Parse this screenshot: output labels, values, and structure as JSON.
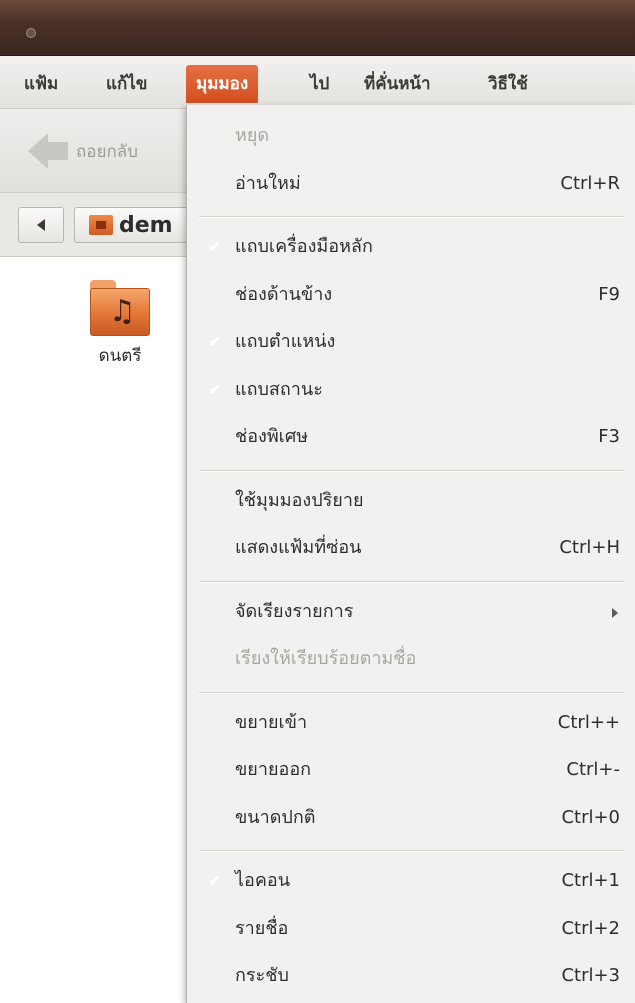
{
  "menubar": {
    "items": [
      {
        "label": "แฟ้ม",
        "active": false
      },
      {
        "label": "แก้ไข",
        "active": false
      },
      {
        "label": "มุมมอง",
        "active": true
      },
      {
        "label": "ไป",
        "active": false
      },
      {
        "label": "ที่คั่นหน้า",
        "active": false
      },
      {
        "label": "วิธีใช้",
        "active": false
      }
    ]
  },
  "toolbar": {
    "back_label": "ถอยกลับ"
  },
  "location": {
    "crumb": "dem"
  },
  "files": [
    {
      "label": "ดนตรี",
      "icon": "music-folder-icon"
    }
  ],
  "view_menu": {
    "items": [
      {
        "type": "item",
        "label": "หยุด",
        "shortcut": "",
        "disabled": true,
        "checked": false,
        "submenu": false
      },
      {
        "type": "item",
        "label": "อ่านใหม่",
        "shortcut": "Ctrl+R",
        "disabled": false,
        "checked": false,
        "submenu": false
      },
      {
        "type": "separator"
      },
      {
        "type": "item",
        "label": "แถบเครื่องมือหลัก",
        "shortcut": "",
        "disabled": false,
        "checked": true,
        "submenu": false
      },
      {
        "type": "item",
        "label": "ช่องด้านข้าง",
        "shortcut": "F9",
        "disabled": false,
        "checked": false,
        "submenu": false
      },
      {
        "type": "item",
        "label": "แถบตำแหน่ง",
        "shortcut": "",
        "disabled": false,
        "checked": true,
        "submenu": false
      },
      {
        "type": "item",
        "label": "แถบสถานะ",
        "shortcut": "",
        "disabled": false,
        "checked": true,
        "submenu": false
      },
      {
        "type": "item",
        "label": "ช่องพิเศษ",
        "shortcut": "F3",
        "disabled": false,
        "checked": false,
        "submenu": false
      },
      {
        "type": "separator"
      },
      {
        "type": "item",
        "label": "ใช้มุมมองปริยาย",
        "shortcut": "",
        "disabled": false,
        "checked": false,
        "submenu": false
      },
      {
        "type": "item",
        "label": "แสดงแฟ้มที่ซ่อน",
        "shortcut": "Ctrl+H",
        "disabled": false,
        "checked": false,
        "submenu": false
      },
      {
        "type": "separator"
      },
      {
        "type": "item",
        "label": "จัดเรียงรายการ",
        "shortcut": "",
        "disabled": false,
        "checked": false,
        "submenu": true
      },
      {
        "type": "item",
        "label": "เรียงให้เรียบร้อยตามชื่อ",
        "shortcut": "",
        "disabled": true,
        "checked": false,
        "submenu": false
      },
      {
        "type": "separator"
      },
      {
        "type": "item",
        "label": "ขยายเข้า",
        "shortcut": "Ctrl++",
        "disabled": false,
        "checked": false,
        "submenu": false
      },
      {
        "type": "item",
        "label": "ขยายออก",
        "shortcut": "Ctrl+-",
        "disabled": false,
        "checked": false,
        "submenu": false
      },
      {
        "type": "item",
        "label": "ขนาดปกติ",
        "shortcut": "Ctrl+0",
        "disabled": false,
        "checked": false,
        "submenu": false
      },
      {
        "type": "separator"
      },
      {
        "type": "item",
        "label": "ไอคอน",
        "shortcut": "Ctrl+1",
        "disabled": false,
        "checked": true,
        "submenu": false
      },
      {
        "type": "item",
        "label": "รายชื่อ",
        "shortcut": "Ctrl+2",
        "disabled": false,
        "checked": false,
        "submenu": false
      },
      {
        "type": "item",
        "label": "กระชับ",
        "shortcut": "Ctrl+3",
        "disabled": false,
        "checked": false,
        "submenu": false
      }
    ]
  },
  "colors": {
    "accent": "#dd5a27",
    "titlebar": "#4a3127",
    "menu_bg": "#f2f1f0"
  }
}
